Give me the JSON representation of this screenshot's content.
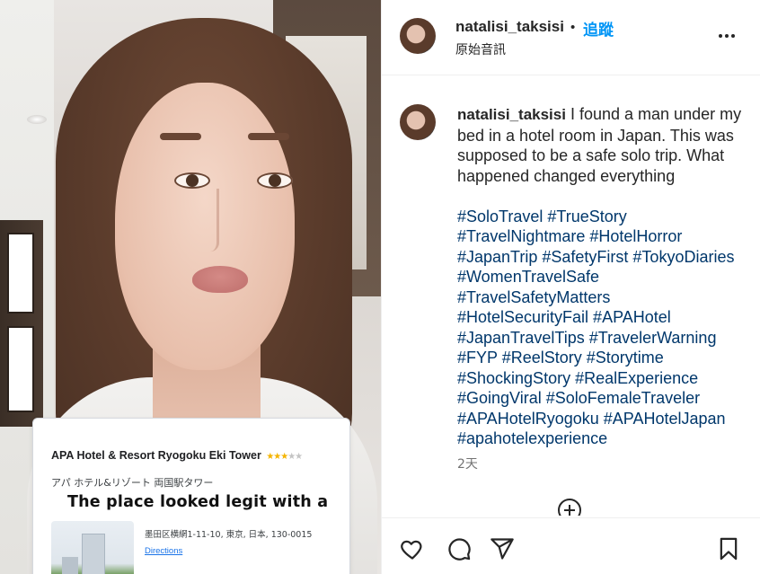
{
  "post": {
    "username": "natalisi_taksisi",
    "separator": "•",
    "follow_label": "追蹤",
    "audio_label": "原始音訊",
    "more_icon": "more-horizontal-icon",
    "caption": "I found a man under my bed in a hotel room in Japan. This was supposed to be a safe solo trip. What happened changed everything",
    "hashtag_lines": [
      "#SoloTravel #TrueStory",
      "#TravelNightmare #HotelHorror",
      "#JapanTrip #SafetyFirst #TokyoDiaries",
      "#WomenTravelSafe",
      "#TravelSafetyMatters",
      "#HotelSecurityFail #APAHotel",
      "#JapanTravelTips #TravelerWarning",
      "#FYP #ReelStory #Storytime",
      "#ShockingStory #RealExperience",
      "#GoingViral #SoloFemaleTraveler",
      "#APAHotelRyogoku #APAHotelJapan",
      "#apahotelexperience"
    ],
    "time_ago": "2天"
  },
  "video": {
    "hotel_name": "APA Hotel & Resort Ryogoku Eki Tower",
    "hotel_stars": "★★★",
    "hotel_stars_off": "★★",
    "hotel_name_jp": "アパ ホテル&リゾート 両国駅タワー",
    "overlay_caption": "The place looked legit with a",
    "hotel_address": "墨田区横網1-11-10, 東京, 日本, 130-0015",
    "directions_label": "Directions"
  },
  "actions": {
    "icons": [
      "heart-icon",
      "comment-icon",
      "share-icon",
      "bookmark-icon"
    ]
  },
  "colors": {
    "link": "#0095f6",
    "hashtag": "#00376b",
    "text": "#262626",
    "muted": "#737373"
  }
}
